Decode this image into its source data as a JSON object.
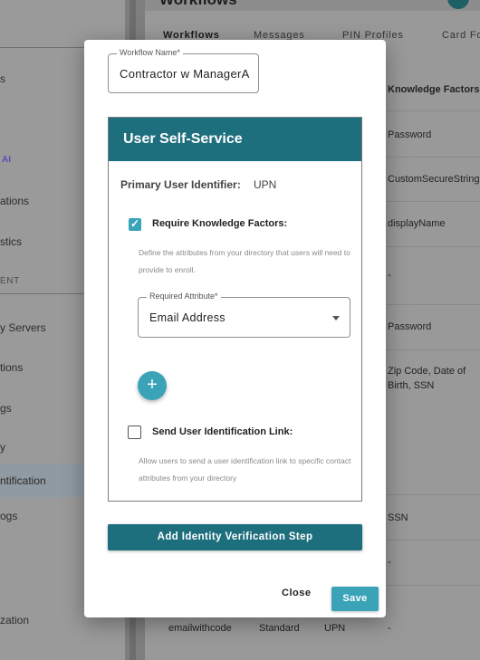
{
  "background": {
    "title": "Workflows",
    "tabs": [
      "Workflows",
      "Messages",
      "PIN Profiles",
      "Card Fo"
    ],
    "sidebar": {
      "items": [
        "s",
        "ations",
        "stics",
        "y Servers",
        "tions",
        "gs",
        "y",
        "ntification",
        "ogs",
        "zation"
      ],
      "ai_badge": "AI",
      "section": "ENT"
    },
    "table": {
      "knowledge_header": "Knowledge Factors",
      "knowledge_values": [
        "Password",
        "CustomSecureString",
        "displayName",
        "-",
        "Password",
        "Zip Code, Date of Birth, SSN",
        "SSN",
        "-",
        "-"
      ],
      "last_row": {
        "name": "emailwithcode",
        "type": "Standard",
        "identifier": "UPN",
        "factors": "-"
      }
    }
  },
  "modal": {
    "workflow_name_label": "Workflow Name*",
    "workflow_name_value": "Contractor w ManagerA",
    "card_title": "User Self-Service",
    "primary_identifier_label": "Primary User Identifier:",
    "primary_identifier_value": "UPN",
    "require_knowledge": {
      "label": "Require Knowledge Factors:",
      "checked": true,
      "help": "Define the attributes from your directory that users will need to provide to enroll."
    },
    "required_attribute": {
      "label": "Required Attribute*",
      "value": "Email Address"
    },
    "add_attribute_icon": "plus-icon",
    "send_link": {
      "label": "Send User Identification Link:",
      "checked": false,
      "help": "Allow users to send a user identification link to specific contact attributes from your directory"
    },
    "add_step_label": "Add Identity Verification Step",
    "close_label": "Close",
    "save_label": "Save",
    "accent_color": "#3aa3b8",
    "header_color": "#1e6f7d"
  }
}
